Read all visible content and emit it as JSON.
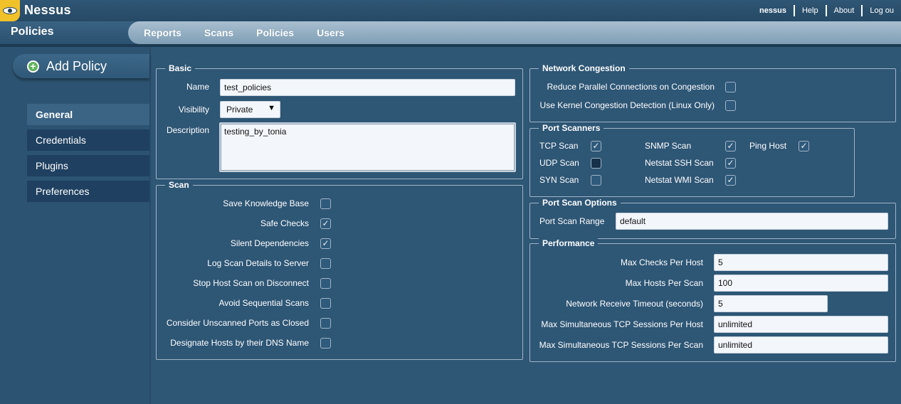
{
  "app": {
    "logo_text": "Nessus"
  },
  "toplinks": {
    "user": "nessus",
    "help": "Help",
    "about": "About",
    "logout": "Log ou"
  },
  "header": {
    "section_title": "Policies"
  },
  "nav": [
    "Reports",
    "Scans",
    "Policies",
    "Users"
  ],
  "add_policy": {
    "label": "Add Policy",
    "icon": "plus-circle-icon",
    "icon_color": "#5fb25a"
  },
  "sidebar": {
    "items": [
      "General",
      "Credentials",
      "Plugins",
      "Preferences"
    ],
    "active_index": 0
  },
  "basic": {
    "legend": "Basic",
    "name_label": "Name",
    "name_value": "test_policies",
    "visibility_label": "Visibility",
    "visibility_value": "Private",
    "description_label": "Description",
    "description_value": "testing_by_tonia"
  },
  "scan": {
    "legend": "Scan",
    "options": [
      {
        "label": "Save Knowledge Base",
        "checked": false
      },
      {
        "label": "Safe Checks",
        "checked": true
      },
      {
        "label": "Silent Dependencies",
        "checked": true
      },
      {
        "label": "Log Scan Details to Server",
        "checked": false
      },
      {
        "label": "Stop Host Scan on Disconnect",
        "checked": false
      },
      {
        "label": "Avoid Sequential Scans",
        "checked": false
      },
      {
        "label": "Consider Unscanned Ports as Closed",
        "checked": false
      },
      {
        "label": "Designate Hosts by their DNS Name",
        "checked": false
      }
    ]
  },
  "network_congestion": {
    "legend": "Network Congestion",
    "options": [
      {
        "label": "Reduce Parallel Connections on Congestion",
        "checked": false
      },
      {
        "label": "Use Kernel Congestion Detection (Linux Only)",
        "checked": false
      }
    ]
  },
  "port_scanners": {
    "legend": "Port Scanners",
    "tcp": {
      "label": "TCP Scan",
      "checked": true
    },
    "udp": {
      "label": "UDP Scan",
      "checked": false
    },
    "syn": {
      "label": "SYN Scan",
      "checked": false
    },
    "snmp": {
      "label": "SNMP Scan",
      "checked": true
    },
    "netstat_ssh": {
      "label": "Netstat SSH Scan",
      "checked": true
    },
    "netstat_wmi": {
      "label": "Netstat WMI Scan",
      "checked": true
    },
    "ping": {
      "label": "Ping Host",
      "checked": true
    }
  },
  "port_scan_options": {
    "legend": "Port Scan Options",
    "range_label": "Port Scan Range",
    "range_value": "default"
  },
  "performance": {
    "legend": "Performance",
    "max_checks_label": "Max Checks Per Host",
    "max_checks_value": "5",
    "max_hosts_label": "Max Hosts Per Scan",
    "max_hosts_value": "100",
    "timeout_label": "Network Receive Timeout (seconds)",
    "timeout_value": "5",
    "tcp_host_label": "Max Simultaneous TCP Sessions Per Host",
    "tcp_host_value": "unlimited",
    "tcp_scan_label": "Max Simultaneous TCP Sessions Per Scan",
    "tcp_scan_value": "unlimited"
  },
  "colors": {
    "background": "#2c5472",
    "navbar": "#8fabc0",
    "input_bg": "#f3f6fb"
  }
}
